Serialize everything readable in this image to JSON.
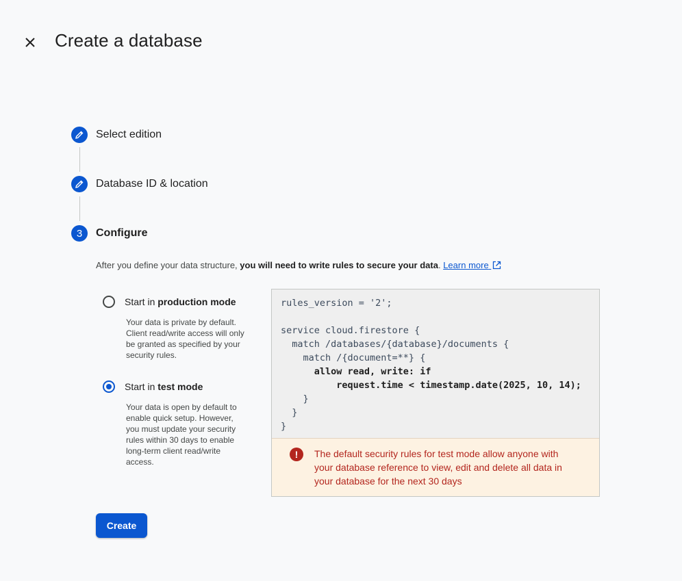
{
  "header": {
    "title": "Create a database",
    "close_icon": "close-icon"
  },
  "stepper": {
    "steps": [
      {
        "label": "Select edition",
        "state": "completed",
        "icon": "pencil-icon"
      },
      {
        "label": "Database ID & location",
        "state": "completed",
        "icon": "pencil-icon"
      },
      {
        "label": "Configure",
        "state": "active",
        "number": "3"
      }
    ]
  },
  "configure": {
    "description_prefix": "After you define your data structure, ",
    "description_bold": "you will need to write rules to secure your data",
    "description_suffix": ". ",
    "learn_more": "Learn more",
    "modes": [
      {
        "label_prefix": "Start in ",
        "label_bold": "production mode",
        "help": "Your data is private by default. Client read/write access will only be granted as specified by your security rules.",
        "checked": false
      },
      {
        "label_prefix": "Start in ",
        "label_bold": "test mode",
        "help": "Your data is open by default to enable quick setup. However, you must update your security rules within 30 days to enable long-term client read/write access.",
        "checked": true
      }
    ],
    "rules_code": {
      "line1": "rules_version = '2';",
      "line2": "",
      "line3": "service cloud.firestore {",
      "line4": "  match /databases/{database}/documents {",
      "line5": "    match /{document=**} {",
      "line6": "      allow read, write: if",
      "line7": "          request.time < timestamp.date(2025, 10, 14);",
      "line8": "    }",
      "line9": "  }",
      "line10": "}"
    },
    "warning": "The default security rules for test mode allow anyone with your database reference to view, edit and delete all data in your database for the next 30 days"
  },
  "actions": {
    "create_label": "Create"
  },
  "colors": {
    "primary": "#0b57d0",
    "error": "#b3261e",
    "warning_bg": "#fdf2e2",
    "code_bg": "#efefef"
  }
}
